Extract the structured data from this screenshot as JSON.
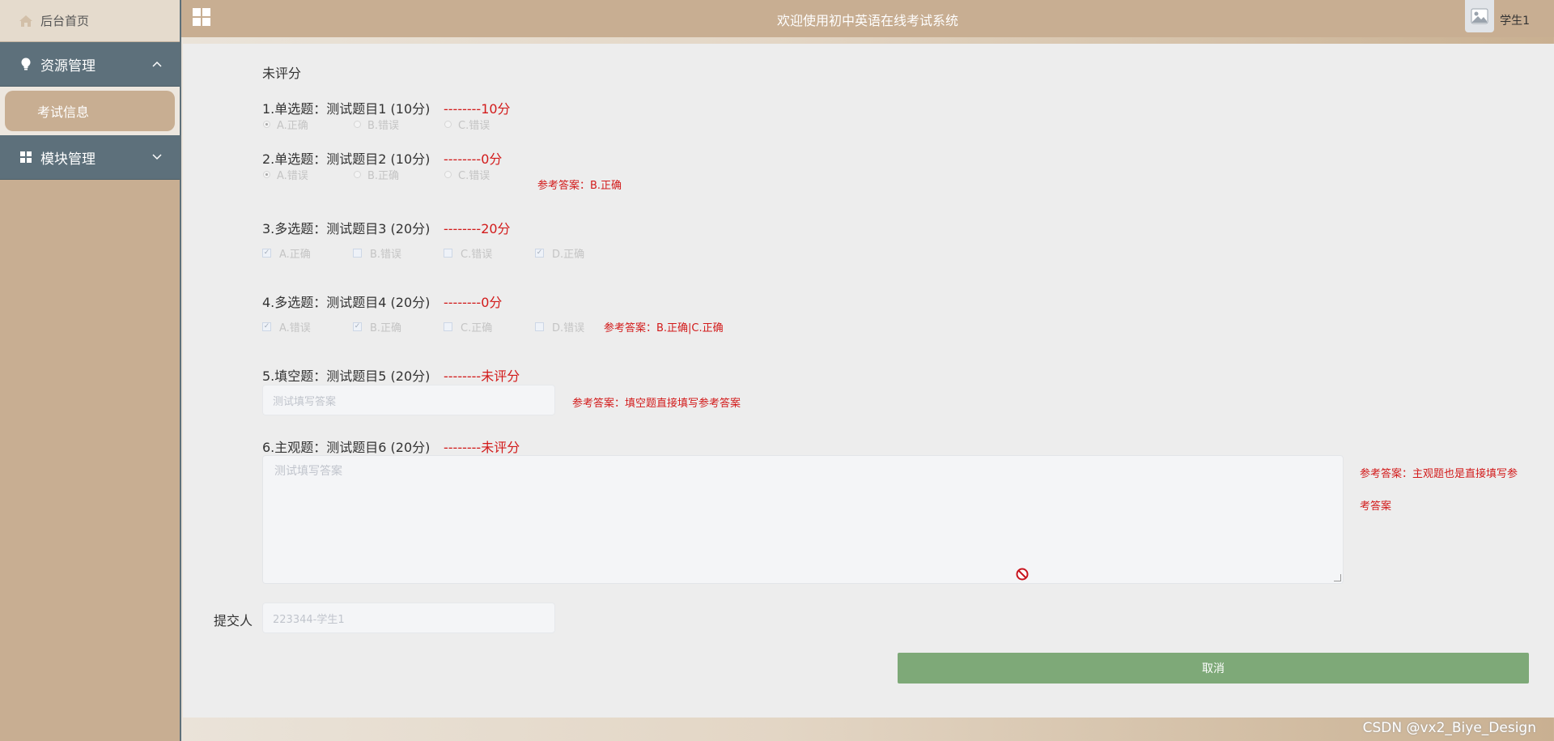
{
  "sidebar": {
    "home_label": "后台首页",
    "groups": [
      {
        "label": "资源管理",
        "arrow": "^",
        "items": [
          {
            "label": "考试信息"
          }
        ]
      },
      {
        "label": "模块管理",
        "arrow": "v"
      }
    ]
  },
  "header": {
    "title": "欢迎使用初中英语在线考试系统",
    "username": "学生1"
  },
  "exam": {
    "status": "未评分",
    "questions": [
      {
        "title": "1.单选题：测试题目1 (10分)",
        "score": "--------10分",
        "options": [
          "A.正确",
          "B.错误",
          "C.错误"
        ],
        "selected": [
          "A"
        ]
      },
      {
        "title": "2.单选题：测试题目2 (10分)",
        "score": "--------0分",
        "options": [
          "A.错误",
          "B.正确",
          "C.错误"
        ],
        "selected": [
          "A"
        ],
        "reference": "参考答案：B.正确"
      },
      {
        "title": "3.多选题：测试题目3 (20分)",
        "score": "--------20分",
        "options": [
          "A.正确",
          "B.错误",
          "C.错误",
          "D.正确"
        ],
        "selected": [
          "A",
          "D"
        ]
      },
      {
        "title": "4.多选题：测试题目4 (20分)",
        "score": "--------0分",
        "options": [
          "A.错误",
          "B.正确",
          "C.正确",
          "D.错误"
        ],
        "selected": [
          "A",
          "B"
        ],
        "reference": "参考答案：B.正确|C.正确"
      },
      {
        "title": "5.填空题：测试题目5 (20分)",
        "score": "--------未评分",
        "answer": "测试填写答案",
        "reference": "参考答案：填空题直接填写参考答案"
      },
      {
        "title": "6.主观题：测试题目6 (20分)",
        "score": "--------未评分",
        "answer": "测试填写答案",
        "reference_line1": "参考答案：主观题也是直接填写参",
        "reference_line2": "考答案"
      }
    ],
    "submitter_label": "提交人",
    "submitter_value": "223344-学生1",
    "cancel_label": "取消"
  },
  "watermark": "CSDN @vx2_Biye_Design",
  "colors": {
    "accent": "#c8ae92",
    "menu_bg": "#5d707b",
    "score_red": "#d21a1a",
    "cancel_green": "#7ea978"
  }
}
